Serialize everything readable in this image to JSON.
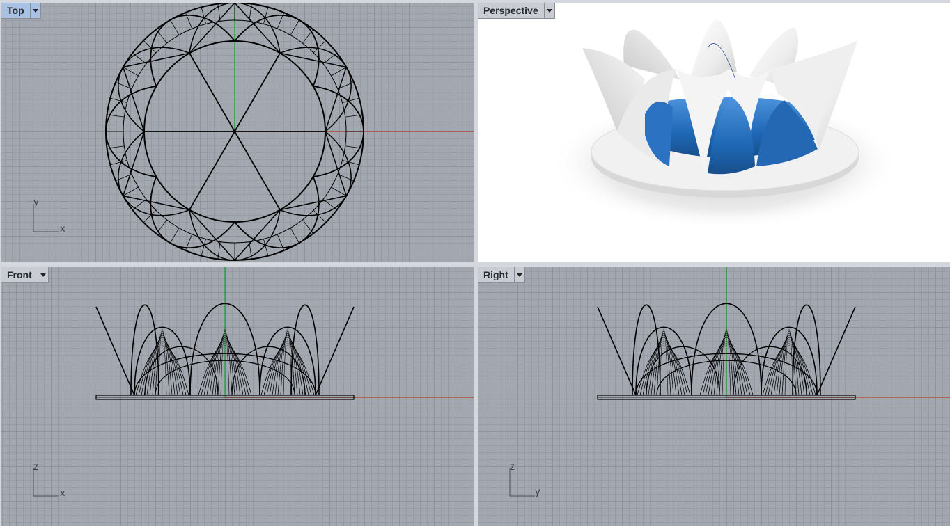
{
  "viewports": {
    "top": {
      "title": "Top",
      "active": true,
      "axis_h": "x",
      "axis_v": "y"
    },
    "persp": {
      "title": "Perspective",
      "active": false
    },
    "front": {
      "title": "Front",
      "active": false,
      "axis_h": "x",
      "axis_v": "z"
    },
    "right": {
      "title": "Right",
      "active": false,
      "axis_h": "y",
      "axis_v": "z"
    }
  },
  "colors": {
    "viewport_bg": "#a2a7b0",
    "x_axis": "#c0392b",
    "y_axis": "#1f9a2e",
    "curve": "#000000",
    "glass": "#1f68b5",
    "shell": "#f2f2f2",
    "active_tab": "#a9c1e3"
  },
  "icons": {
    "tab_dropdown": "chevron-down-icon",
    "world_axes": "axes-icon"
  }
}
